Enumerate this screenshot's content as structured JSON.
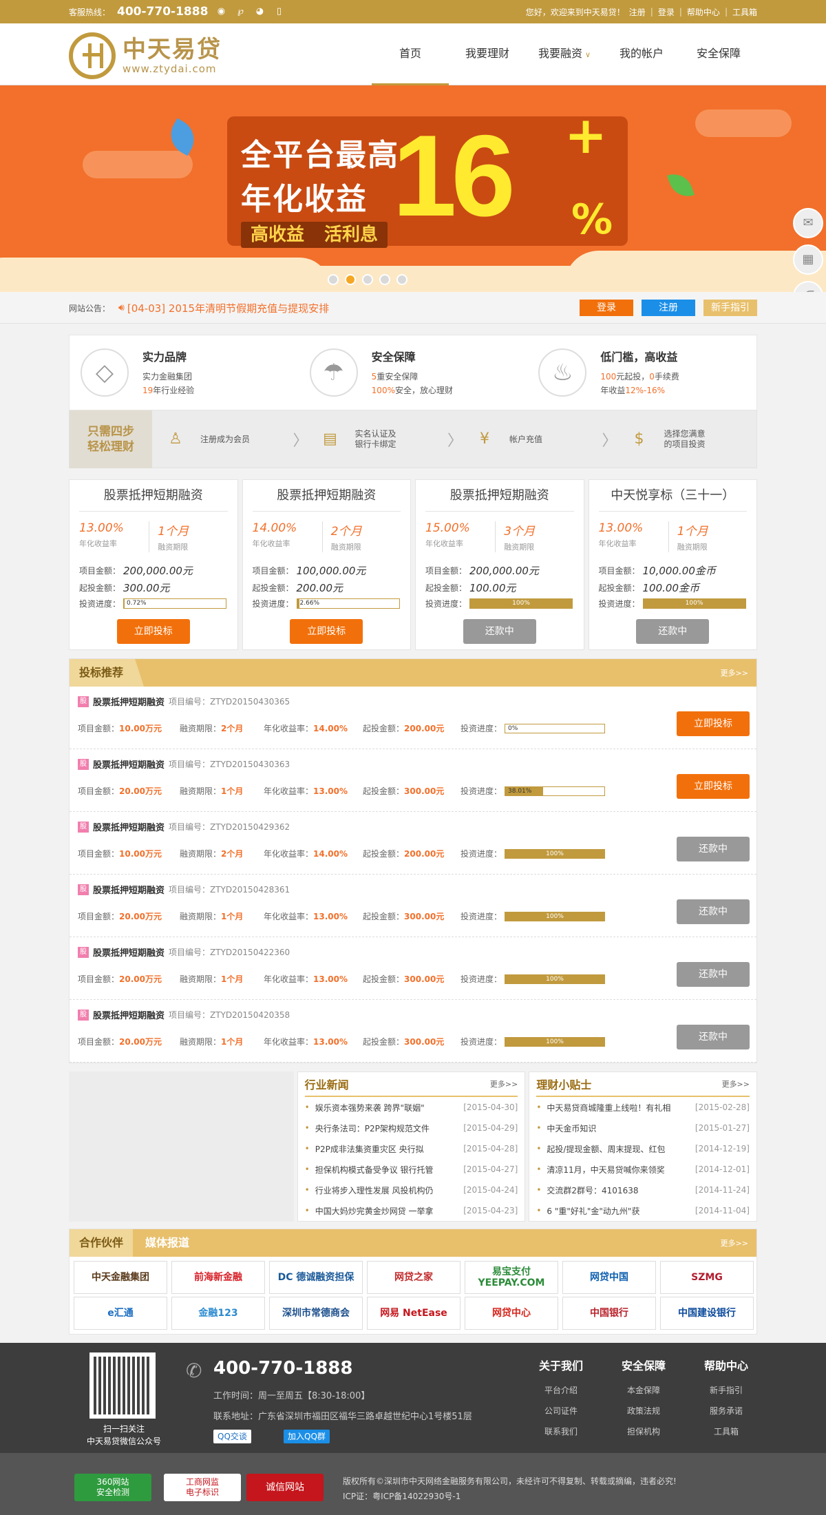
{
  "topbar": {
    "hotline_label": "客服热线：",
    "hotline": "400-770-1888",
    "icons": [
      "weibo-icon",
      "tencent-weibo-icon",
      "wechat-icon",
      "mobile-icon"
    ],
    "welcome": "您好，欢迎来到中天易贷！",
    "links": [
      "注册",
      "登录",
      "帮助中心",
      "工具箱"
    ]
  },
  "header": {
    "logo_cn": "中天易贷",
    "logo_en": "www.ztydai.com",
    "nav": [
      {
        "label": "首页",
        "active": true
      },
      {
        "label": "我要理财"
      },
      {
        "label": "我要融资",
        "dropdown": true
      },
      {
        "label": "我的帐户"
      },
      {
        "label": "安全保障"
      }
    ]
  },
  "banner": {
    "line1": "全平台最高",
    "line2": "年化收益",
    "tag": "高收益 活利息",
    "rate": "16",
    "plus": "+",
    "pct": "%",
    "slides": 5,
    "active_slide": 1
  },
  "notice": {
    "label": "网站公告：",
    "text": "[04-03] 2015年清明节假期充值与提现安排",
    "buttons": [
      "登录",
      "注册",
      "新手指引"
    ],
    "button_colors": [
      "#f2700b",
      "#1b8fe8",
      "#e8c06c"
    ]
  },
  "features": [
    {
      "title": "实力品牌",
      "l1": "实力金融集团",
      "l2_num": "19",
      "l2": "年行业经验",
      "icon": "diamond-icon"
    },
    {
      "title": "安全保障",
      "l1_num": "5",
      "l1": "重安全保障",
      "l2_num": "100%",
      "l2": "安全，放心理财",
      "icon": "umbrella-icon"
    },
    {
      "title": "低门槛，高收益",
      "l1_num": "100",
      "l1": "元起投，",
      "l1_num2": "0",
      "l1b": "手续费",
      "l2": "年收益",
      "l2_num": "12%-16%",
      "icon": "piggy-bank-icon"
    }
  ],
  "steps": {
    "title1": "只需四步",
    "title2": "轻松理财",
    "items": [
      {
        "text": "注册成为会员",
        "icon": "user-icon"
      },
      {
        "text": "实名认证及\n银行卡绑定",
        "icon": "id-card-icon"
      },
      {
        "text": "帐户充值",
        "icon": "yen-icon"
      },
      {
        "text": "选择您满意\n的项目投资",
        "icon": "money-bag-icon"
      }
    ]
  },
  "cards": [
    {
      "title": "股票抵押短期融资",
      "rate": "13.00%",
      "rate_label": "年化收益率",
      "term": "1个月",
      "term_label": "融资期限",
      "amount_label": "项目金额：",
      "amount": "200,000.00元",
      "min_label": "起投金额：",
      "min": "300.00元",
      "prog_label": "投资进度：",
      "progress": "0.72%",
      "progress_val": 0.72,
      "button": "立即投标",
      "status": "go"
    },
    {
      "title": "股票抵押短期融资",
      "rate": "14.00%",
      "rate_label": "年化收益率",
      "term": "2个月",
      "term_label": "融资期限",
      "amount_label": "项目金额：",
      "amount": "100,000.00元",
      "min_label": "起投金额：",
      "min": "200.00元",
      "prog_label": "投资进度：",
      "progress": "2.66%",
      "progress_val": 2.66,
      "button": "立即投标",
      "status": "go"
    },
    {
      "title": "股票抵押短期融资",
      "rate": "15.00%",
      "rate_label": "年化收益率",
      "term": "3个月",
      "term_label": "融资期限",
      "amount_label": "项目金额：",
      "amount": "200,000.00元",
      "min_label": "起投金额：",
      "min": "100.00元",
      "prog_label": "投资进度：",
      "progress": "100%",
      "progress_val": 100,
      "button": "还款中",
      "status": "gray"
    },
    {
      "title": "中天悦享标（三十一）",
      "rate": "13.00%",
      "rate_label": "年化收益率",
      "term": "1个月",
      "term_label": "融资期限",
      "amount_label": "项目金额：",
      "amount": "10,000.00金币",
      "min_label": "起投金额：",
      "min": "100.00金币",
      "prog_label": "投资进度：",
      "progress": "100%",
      "progress_val": 100,
      "button": "还款中",
      "status": "gray"
    }
  ],
  "recommend": {
    "title": "投标推荐",
    "more": "更多>>",
    "badge": "股",
    "labels": {
      "code": "项目编号：",
      "amount": "项目金额：",
      "term": "融资期限：",
      "rate": "年化收益率：",
      "min": "起投金额：",
      "prog": "投资进度："
    },
    "rows": [
      {
        "name": "股票抵押短期融资",
        "code": "ZTYD20150430365",
        "amount": "10.00万元",
        "term": "2个月",
        "rate": "14.00%",
        "min": "200.00元",
        "progress": "0%",
        "progress_val": 0,
        "button": "立即投标",
        "status": "go"
      },
      {
        "name": "股票抵押短期融资",
        "code": "ZTYD20150430363",
        "amount": "20.00万元",
        "term": "1个月",
        "rate": "13.00%",
        "min": "300.00元",
        "progress": "38.01%",
        "progress_val": 38.01,
        "button": "立即投标",
        "status": "go"
      },
      {
        "name": "股票抵押短期融资",
        "code": "ZTYD20150429362",
        "amount": "10.00万元",
        "term": "2个月",
        "rate": "14.00%",
        "min": "200.00元",
        "progress": "100%",
        "progress_val": 100,
        "button": "还款中",
        "status": "gray"
      },
      {
        "name": "股票抵押短期融资",
        "code": "ZTYD20150428361",
        "amount": "20.00万元",
        "term": "1个月",
        "rate": "13.00%",
        "min": "300.00元",
        "progress": "100%",
        "progress_val": 100,
        "button": "还款中",
        "status": "gray"
      },
      {
        "name": "股票抵押短期融资",
        "code": "ZTYD20150422360",
        "amount": "20.00万元",
        "term": "1个月",
        "rate": "13.00%",
        "min": "300.00元",
        "progress": "100%",
        "progress_val": 100,
        "button": "还款中",
        "status": "gray"
      },
      {
        "name": "股票抵押短期融资",
        "code": "ZTYD20150420358",
        "amount": "20.00万元",
        "term": "1个月",
        "rate": "13.00%",
        "min": "300.00元",
        "progress": "100%",
        "progress_val": 100,
        "button": "还款中",
        "status": "gray"
      }
    ]
  },
  "news": {
    "industry_title": "行业新闻",
    "tips_title": "理财小贴士",
    "more": "更多>>",
    "industry": [
      [
        "娱乐资本强势来袭 跨界\"联姻\"",
        "[2015-04-30]"
      ],
      [
        "央行条法司：P2P架构规范文件",
        "[2015-04-29]"
      ],
      [
        "P2P成非法集资重灾区 央行拟",
        "[2015-04-28]"
      ],
      [
        "担保机构模式备受争议 银行托管",
        "[2015-04-27]"
      ],
      [
        "行业将步入理性发展 风投机构仍",
        "[2015-04-24]"
      ],
      [
        "中国大妈炒完黄金炒网贷 一举拿",
        "[2015-04-23]"
      ]
    ],
    "tips": [
      [
        "中天易贷商城隆重上线啦！有礼相",
        "[2015-02-28]"
      ],
      [
        "中天金币知识",
        "[2015-01-27]"
      ],
      [
        "起投/提现金额、周末提现、红包",
        "[2014-12-19]"
      ],
      [
        "清凉11月，中天易贷喊你来领奖",
        "[2014-12-01]"
      ],
      [
        "交流群2群号：4101638",
        "[2014-11-24]"
      ],
      [
        "6 \"重\"好礼\"金\"动九州\"获",
        "[2014-11-04]"
      ]
    ]
  },
  "partners": {
    "tab1": "合作伙伴",
    "tab2": "媒体报道",
    "more": "更多>>",
    "logos": [
      [
        "中天金融集团",
        "#5a3a1a"
      ],
      [
        "前海新金融",
        "#d71f26"
      ],
      [
        "DC 德诚融资担保",
        "#1b5a9a"
      ],
      [
        "网贷之家",
        "#c22c2c"
      ],
      [
        "易宝支付 YEEPAY.COM",
        "#2c8c3a"
      ],
      [
        "网贷中国",
        "#0e5fb0"
      ],
      [
        "SZMG",
        "#b31c2e"
      ],
      [
        "e汇通",
        "#1b6ec2"
      ],
      [
        "金融123",
        "#2a8ad0"
      ],
      [
        "深圳市常德商会",
        "#1b4f8c"
      ],
      [
        "网易 NetEase",
        "#c4161c"
      ],
      [
        "网贷中心",
        "#d6261d"
      ],
      [
        "中国银行",
        "#b8222a"
      ],
      [
        "中国建设银行",
        "#0a4a9c"
      ]
    ]
  },
  "footer": {
    "qr_caption1": "扫一扫关注",
    "qr_caption2": "中天易贷微信公众号",
    "phone": "400-770-1888",
    "hours": "工作时间：周一至周五【8:30-18:00】",
    "address": "联系地址：广东省深圳市福田区福华三路卓越世纪中心1号楼51层",
    "qq1": "QQ交谈",
    "qq2": "加入QQ群",
    "cols": [
      {
        "title": "关于我们",
        "items": [
          "平台介绍",
          "公司证件",
          "联系我们"
        ]
      },
      {
        "title": "安全保障",
        "items": [
          "本金保障",
          "政策法规",
          "担保机构"
        ]
      },
      {
        "title": "帮助中心",
        "items": [
          "新手指引",
          "服务承诺",
          "工具箱"
        ]
      }
    ]
  },
  "copyright": {
    "badges": [
      "360网站\n安全检测",
      "工商网监\n电子标识",
      "诚信网站"
    ],
    "line1": "版权所有©深圳市中天网络金融服务有限公司，未经许可不得复制、转载或摘编，违者必究!",
    "line2": "ICP证：粤ICP备14022930号-1"
  }
}
